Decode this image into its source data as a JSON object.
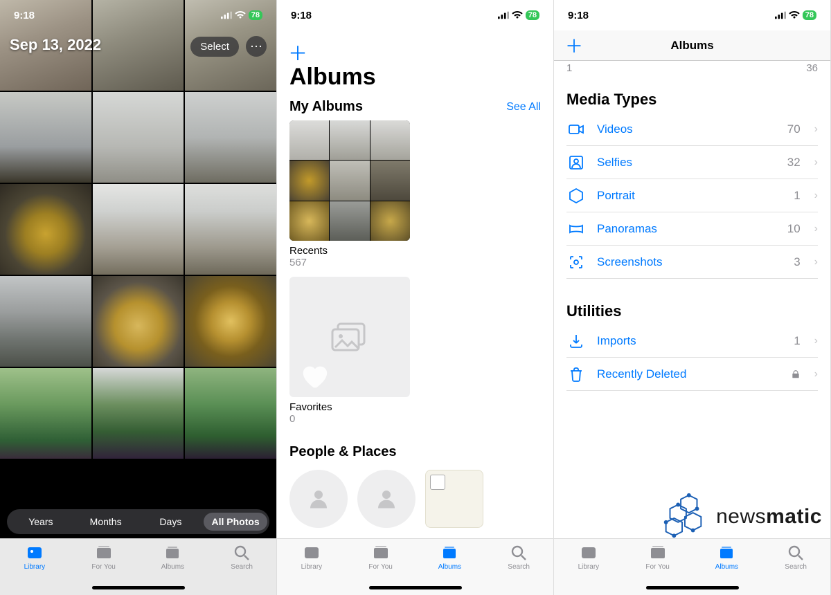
{
  "status": {
    "time": "9:18",
    "battery": "78"
  },
  "screen1": {
    "date": "Sep 13, 2022",
    "select_label": "Select",
    "filters": {
      "years": "Years",
      "months": "Months",
      "days": "Days",
      "all": "All Photos"
    },
    "tabs": {
      "library": "Library",
      "forYou": "For You",
      "albums": "Albums",
      "search": "Search"
    }
  },
  "screen2": {
    "title": "Albums",
    "my_albums": "My Albums",
    "see_all": "See All",
    "recents": {
      "name": "Recents",
      "count": "567"
    },
    "favorites": {
      "name": "Favorites",
      "count": "0"
    },
    "people_places": "People & Places",
    "tabs": {
      "library": "Library",
      "forYou": "For You",
      "albums": "Albums",
      "search": "Search"
    }
  },
  "screen3": {
    "nav_title": "Albums",
    "faded": {
      "left": "1",
      "right": "36"
    },
    "media_types": "Media Types",
    "media": [
      {
        "label": "Videos",
        "count": "70"
      },
      {
        "label": "Selfies",
        "count": "32"
      },
      {
        "label": "Portrait",
        "count": "1"
      },
      {
        "label": "Panoramas",
        "count": "10"
      },
      {
        "label": "Screenshots",
        "count": "3"
      }
    ],
    "utilities": "Utilities",
    "util": [
      {
        "label": "Imports",
        "count": "1"
      },
      {
        "label": "Recently Deleted",
        "count": ""
      }
    ],
    "tabs": {
      "library": "Library",
      "forYou": "For You",
      "albums": "Albums",
      "search": "Search"
    }
  },
  "watermark": {
    "brand1": "news",
    "brand2": "matic"
  }
}
